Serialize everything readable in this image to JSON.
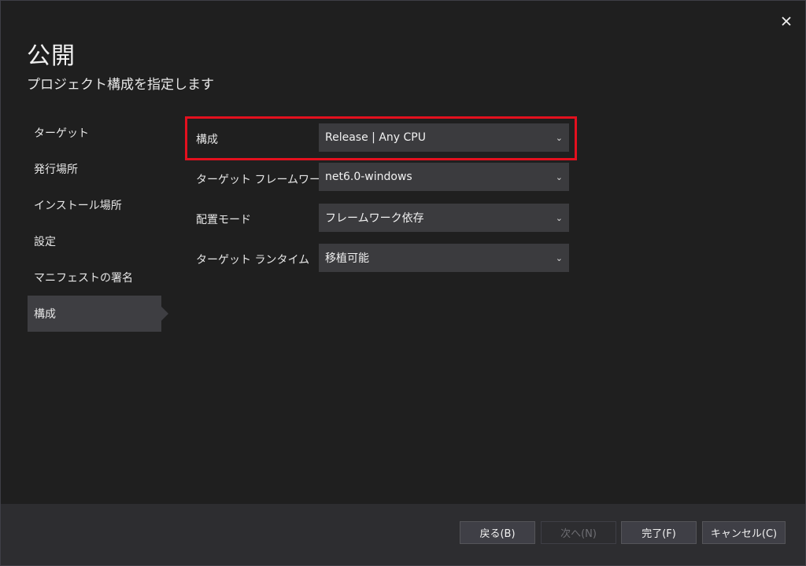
{
  "dialog": {
    "title": "公開",
    "subtitle": "プロジェクト構成を指定します"
  },
  "nav": {
    "items": [
      {
        "label": "ターゲット"
      },
      {
        "label": "発行場所"
      },
      {
        "label": "インストール場所"
      },
      {
        "label": "設定"
      },
      {
        "label": "マニフェストの署名"
      },
      {
        "label": "構成"
      }
    ],
    "active": "構成"
  },
  "form": {
    "configuration": {
      "label": "構成",
      "value": "Release | Any CPU"
    },
    "target_framework": {
      "label": "ターゲット フレームワーク",
      "value": "net6.0-windows"
    },
    "deployment_mode": {
      "label": "配置モード",
      "value": "フレームワーク依存"
    },
    "target_runtime": {
      "label": "ターゲット ランタイム",
      "value": "移植可能"
    }
  },
  "buttons": {
    "back": "戻る(B)",
    "next": "次へ(N)",
    "finish": "完了(F)",
    "cancel": "キャンセル(C)"
  },
  "colors": {
    "background": "#1f1f1f",
    "highlight": "#e3101e",
    "select_bg": "#3b3b3e",
    "footer_bg": "#2d2d30"
  }
}
